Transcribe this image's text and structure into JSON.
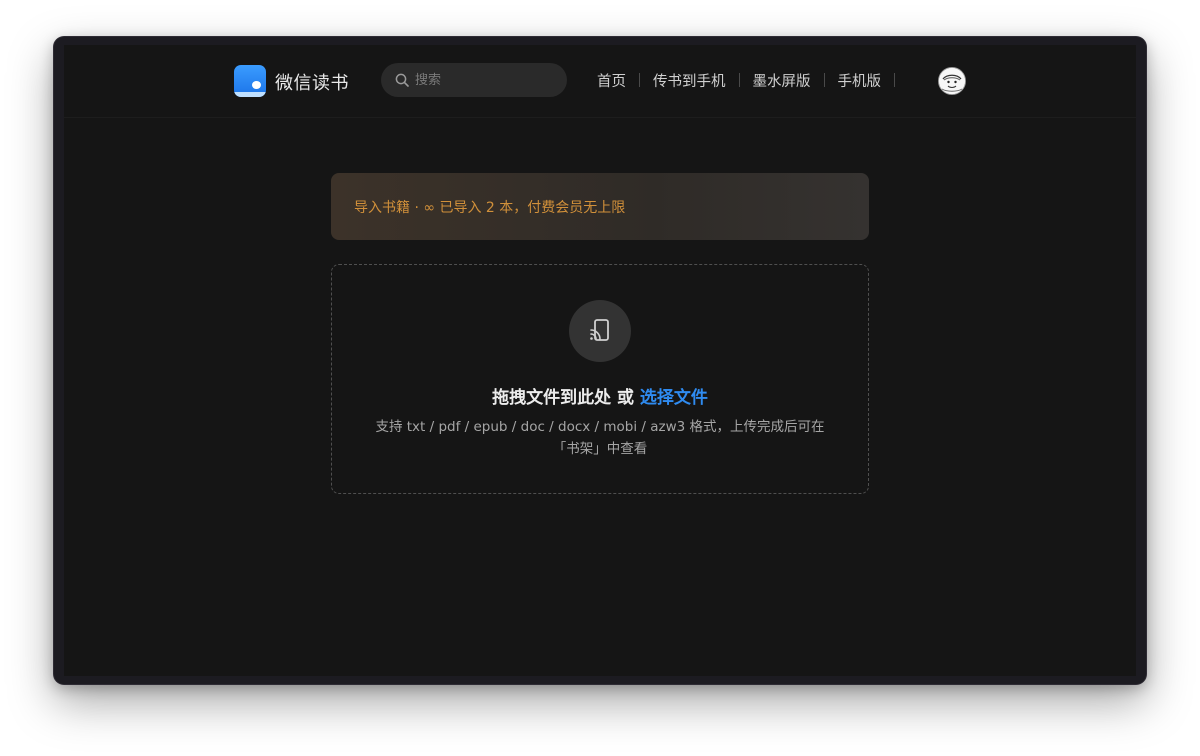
{
  "header": {
    "app_name": "微信读书",
    "search_placeholder": "搜索",
    "nav": [
      {
        "label": "首页"
      },
      {
        "label": "传书到手机"
      },
      {
        "label": "墨水屏版"
      },
      {
        "label": "手机版"
      }
    ]
  },
  "banner": {
    "text": "导入书籍 · ∞ 已导入 2 本，付费会员无上限"
  },
  "dropzone": {
    "title_prefix": "拖拽文件到此处 或",
    "select_link": "选择文件",
    "hint_line1": "支持 txt / pdf / epub / doc / docx / mobi / azw3 格式，上传完成后可在",
    "hint_line2": "「书架」中查看"
  },
  "colors": {
    "accent_blue": "#2f8bf0",
    "banner_orange": "#d1903a",
    "page_bg": "#151515"
  }
}
